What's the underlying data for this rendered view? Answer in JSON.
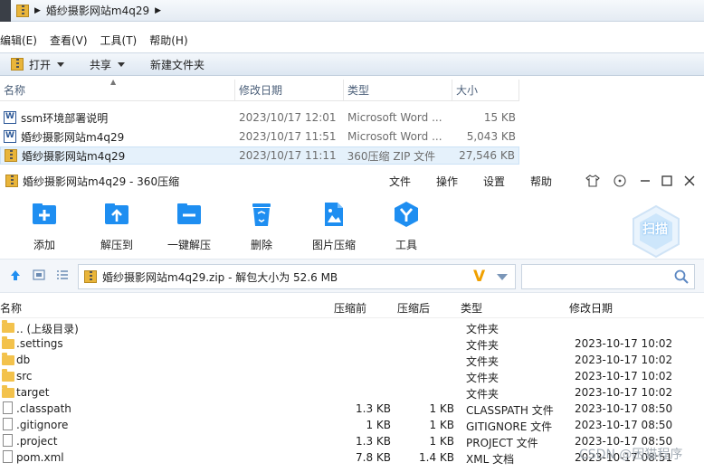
{
  "explorer": {
    "breadcrumb": "婚纱摄影网站m4q29",
    "menu": [
      "编辑(E)",
      "查看(V)",
      "工具(T)",
      "帮助(H)"
    ],
    "commands": {
      "open": "打开",
      "share": "共享",
      "new_folder": "新建文件夹"
    },
    "columns": {
      "name": "名称",
      "date": "修改日期",
      "type": "类型",
      "size": "大小"
    },
    "files": [
      {
        "name": "ssm环境部署说明",
        "date": "2023/10/17 12:01",
        "type": "Microsoft Word ...",
        "size": "15 KB",
        "icon": "word-doc-icon"
      },
      {
        "name": "婚纱摄影网站m4q29",
        "date": "2023/10/17 11:51",
        "type": "Microsoft Word ...",
        "size": "5,043 KB",
        "icon": "word-doc-icon"
      },
      {
        "name": "婚纱摄影网站m4q29",
        "date": "2023/10/17 11:11",
        "type": "360压缩 ZIP 文件",
        "size": "27,546 KB",
        "icon": "zip-icon",
        "selected": true
      }
    ]
  },
  "zip360": {
    "title": "婚纱摄影网站m4q29 - 360压缩",
    "menu": [
      "文件",
      "操作",
      "设置",
      "帮助"
    ],
    "tools": [
      "添加",
      "解压到",
      "一键解压",
      "删除",
      "图片压缩",
      "工具"
    ],
    "scan_label": "扫描",
    "path": "婚纱摄影网站m4q29.zip - 解包大小为 52.6 MB",
    "columns": {
      "name": "名称",
      "compressed": "压缩前",
      "packed": "压缩后",
      "type": "类型",
      "modified": "修改日期"
    },
    "rows": [
      {
        "name": ".. (上级目录)",
        "orig": "",
        "packed": "",
        "type": "文件夹",
        "date": "",
        "icon": "folder"
      },
      {
        "name": ".settings",
        "orig": "",
        "packed": "",
        "type": "文件夹",
        "date": "2023-10-17 10:02",
        "icon": "folder"
      },
      {
        "name": "db",
        "orig": "",
        "packed": "",
        "type": "文件夹",
        "date": "2023-10-17 10:02",
        "icon": "folder"
      },
      {
        "name": "src",
        "orig": "",
        "packed": "",
        "type": "文件夹",
        "date": "2023-10-17 10:02",
        "icon": "folder"
      },
      {
        "name": "target",
        "orig": "",
        "packed": "",
        "type": "文件夹",
        "date": "2023-10-17 10:02",
        "icon": "folder"
      },
      {
        "name": ".classpath",
        "orig": "1.3 KB",
        "packed": "1 KB",
        "type": "CLASSPATH 文件",
        "date": "2023-10-17 08:50",
        "icon": "file"
      },
      {
        "name": ".gitignore",
        "orig": "1 KB",
        "packed": "1 KB",
        "type": "GITIGNORE 文件",
        "date": "2023-10-17 08:50",
        "icon": "file"
      },
      {
        "name": ".project",
        "orig": "1.3 KB",
        "packed": "1 KB",
        "type": "PROJECT 文件",
        "date": "2023-10-17 08:50",
        "icon": "file"
      },
      {
        "name": "pom.xml",
        "orig": "7.8 KB",
        "packed": "1.4 KB",
        "type": "XML 文档",
        "date": "2023-10-17 08:51",
        "icon": "file"
      }
    ],
    "watermark": "CSDN @困猫程序"
  }
}
